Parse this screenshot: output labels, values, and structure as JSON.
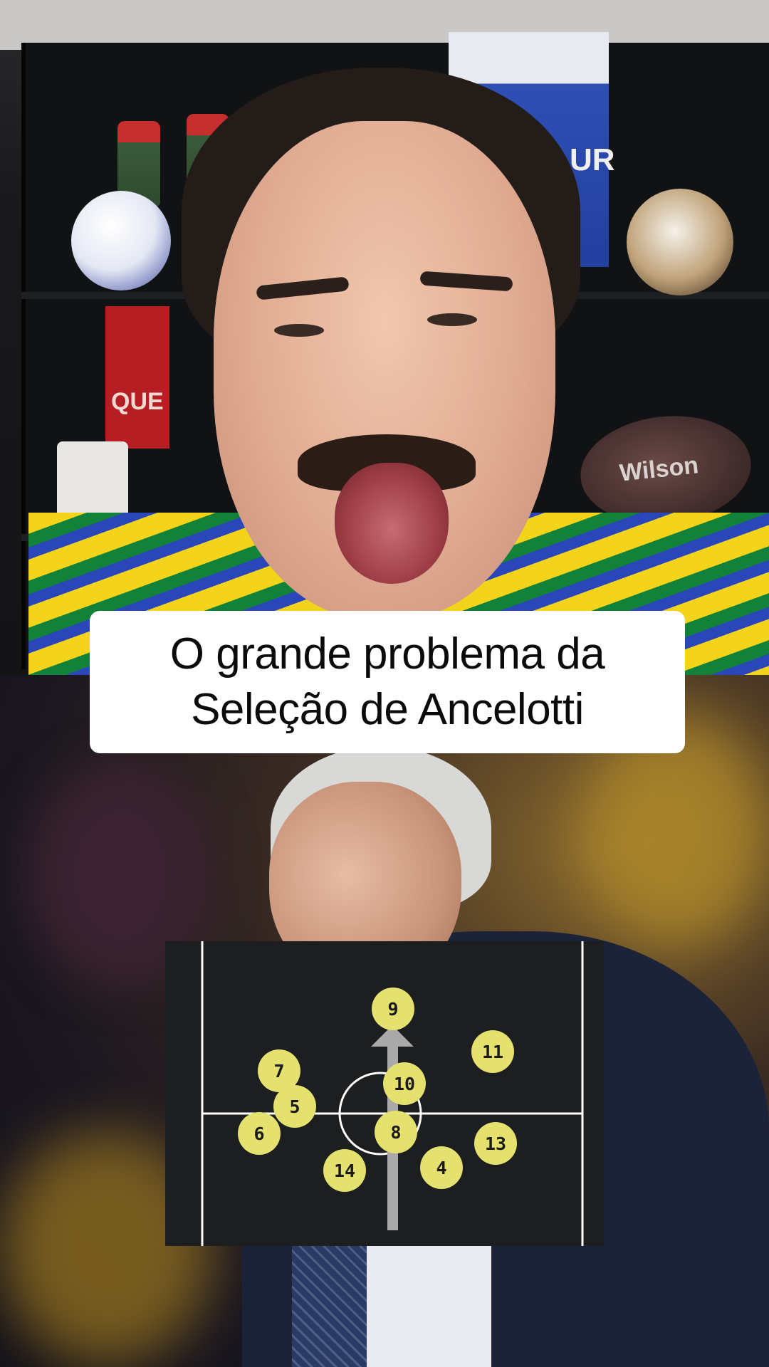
{
  "caption": {
    "line1": "O grande problema da",
    "line2": "Seleção de Ancelotti"
  },
  "background_props": {
    "banner_text": "UR",
    "book_text": "QUE",
    "football_text": "Wilson"
  },
  "colors": {
    "player_dot": "#e5e16e",
    "pitch_background": "#1c1e20",
    "pitch_lines": "#ffffff",
    "arrow": "#a9a9a9"
  },
  "formation": {
    "players": [
      {
        "number": "9"
      },
      {
        "number": "11"
      },
      {
        "number": "7"
      },
      {
        "number": "10"
      },
      {
        "number": "5"
      },
      {
        "number": "8"
      },
      {
        "number": "6"
      },
      {
        "number": "13"
      },
      {
        "number": "14"
      },
      {
        "number": "4"
      }
    ]
  }
}
